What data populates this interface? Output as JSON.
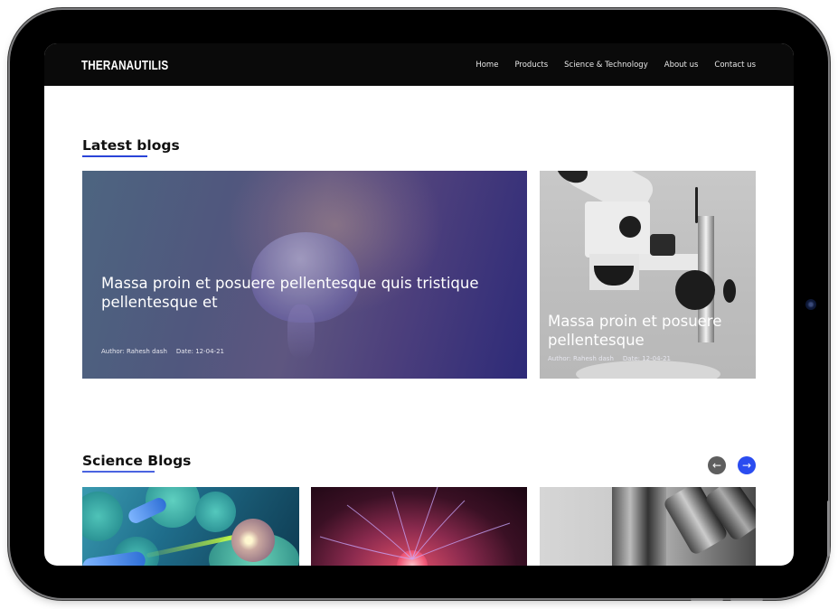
{
  "brand": {
    "name": "THERANAUTILIS"
  },
  "nav": {
    "items": [
      {
        "label": "Home"
      },
      {
        "label": "Products"
      },
      {
        "label": "Science & Technology"
      },
      {
        "label": "About us"
      },
      {
        "label": "Contact us"
      }
    ]
  },
  "latest": {
    "title": "Latest blogs",
    "featured": {
      "title": "Massa proin et posuere pellentesque quis tristique pellentesque et",
      "author": "Author: Rahesh dash",
      "date": "Date: 12-04-21",
      "image": "brain-image"
    },
    "secondary": {
      "title": "Massa proin et posuere pellentesque",
      "author": "Author: Rahesh dash",
      "date": "Date: 12-04-21",
      "image": "microscope-image"
    }
  },
  "science": {
    "title": "Science Blogs",
    "prev_icon": "arrow-left-icon",
    "next_icon": "arrow-right-icon",
    "prev_glyph": "←",
    "next_glyph": "→",
    "cards": [
      {
        "image": "nanobot-bacteria-image"
      },
      {
        "image": "plasma-ball-image"
      },
      {
        "image": "microscope-lens-image"
      }
    ]
  },
  "colors": {
    "accent": "#2a4cf0",
    "navbar": "#0a0a0a",
    "underline": "#2a44d8"
  }
}
